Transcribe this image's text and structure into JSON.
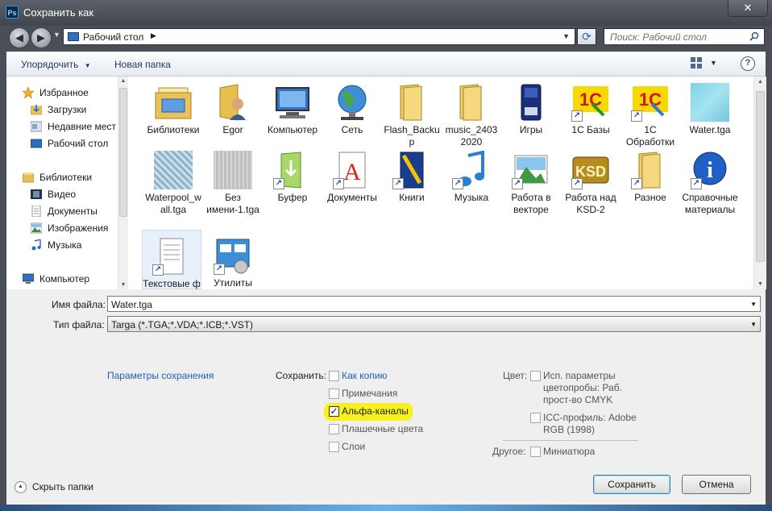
{
  "window": {
    "title": "Сохранить как",
    "app_icon": "Ps",
    "close_glyph": "✕"
  },
  "nav": {
    "back_glyph": "◀",
    "forward_glyph": "▶",
    "address": "Рабочий стол",
    "address_sep": "▶",
    "search_placeholder": "Поиск: Рабочий стол"
  },
  "toolbar": {
    "organize": "Упорядочить",
    "new_folder": "Новая папка",
    "help": "?"
  },
  "sidebar": {
    "favorites": "Избранное",
    "downloads": "Загрузки",
    "recent": "Недавние мест",
    "desktop": "Рабочий стол",
    "libraries": "Библиотеки",
    "video": "Видео",
    "documents": "Документы",
    "images": "Изображения",
    "music": "Музыка",
    "computer": "Компьютер"
  },
  "files": [
    {
      "name": "Библиотеки",
      "icon": "libraries-folder"
    },
    {
      "name": "Egor",
      "icon": "user-folder"
    },
    {
      "name": "Компьютер",
      "icon": "computer"
    },
    {
      "name": "Сеть",
      "icon": "network-globe"
    },
    {
      "name": "Flash_Backup",
      "icon": "folder"
    },
    {
      "name": "music_2403 2020",
      "icon": "folder"
    },
    {
      "name": "Игры",
      "icon": "games"
    },
    {
      "name": "1С Базы",
      "icon": "1c-logo"
    },
    {
      "name": "1С Обработки",
      "icon": "1c-logo"
    },
    {
      "name": "Water.tga",
      "icon": "water-texture"
    },
    {
      "name": "Waterpool_wall.tga",
      "icon": "tile-texture"
    },
    {
      "name": "Без имени-1.tga",
      "icon": "noise-texture"
    },
    {
      "name": "Буфер",
      "icon": "folder-shortcut"
    },
    {
      "name": "Документы",
      "icon": "document-shortcut"
    },
    {
      "name": "Книги",
      "icon": "book-shortcut"
    },
    {
      "name": "Музыка",
      "icon": "music-shortcut"
    },
    {
      "name": "Работа в векторе",
      "icon": "vector-shortcut"
    },
    {
      "name": "Работа над KSD-2",
      "icon": "ksd-logo"
    },
    {
      "name": "Разное",
      "icon": "folder-shortcut"
    },
    {
      "name": "Справочные материалы",
      "icon": "info-shortcut"
    },
    {
      "name": "Текстовые ф",
      "icon": "text-shortcut"
    },
    {
      "name": "Утилиты",
      "icon": "utilities-shortcut"
    }
  ],
  "form": {
    "filename_label": "Имя файла:",
    "filename_value": "Water.tga",
    "filetype_label": "Тип файла:",
    "filetype_value": "Targa (*.TGA;*.VDA;*.ICB;*.VST)"
  },
  "options": {
    "params_link": "Параметры сохранения",
    "save_label": "Сохранить:",
    "as_copy": "Как копию",
    "notes": "Примечания",
    "alpha": "Альфа-каналы",
    "alpha_checked": true,
    "spot": "Плашечные цвета",
    "layers": "Слои",
    "color_label": "Цвет:",
    "proof_line1": "Исп. параметры",
    "proof_line2": "цветопробы:  Раб.",
    "proof_line3": "прост-во CMYK",
    "icc_line1": "ICC-профиль:  Adobe",
    "icc_line2": "RGB (1998)",
    "other_label": "Другое:",
    "thumbnail": "Миниатюра",
    "check_glyph": "✓"
  },
  "footer": {
    "hide_folders": "Скрыть папки",
    "save_btn": "Сохранить",
    "cancel_btn": "Отмена"
  }
}
